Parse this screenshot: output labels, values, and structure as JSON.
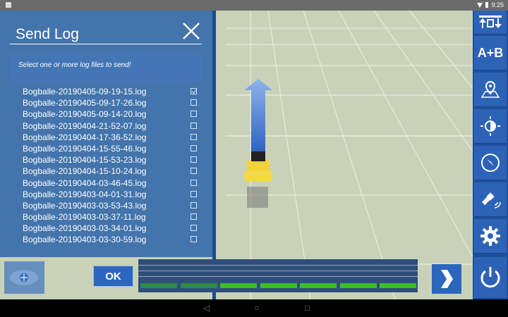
{
  "status": {
    "time": "9:25"
  },
  "dialog": {
    "title": "Send Log",
    "hint": "Select one or more log files to send!",
    "files": [
      {
        "name": "Bogballe-20190405-09-19-15.log",
        "checked": true
      },
      {
        "name": "Bogballe-20190405-09-17-26.log",
        "checked": false
      },
      {
        "name": "Bogballe-20190405-09-14-20.log",
        "checked": false
      },
      {
        "name": "Bogballe-20190404-21-52-07.log",
        "checked": false
      },
      {
        "name": "Bogballe-20190404-17-36-52.log",
        "checked": false
      },
      {
        "name": "Bogballe-20190404-15-55-46.log",
        "checked": false
      },
      {
        "name": "Bogballe-20190404-15-53-23.log",
        "checked": false
      },
      {
        "name": "Bogballe-20190404-15-10-24.log",
        "checked": false
      },
      {
        "name": "Bogballe-20190404-03-46-45.log",
        "checked": false
      },
      {
        "name": "Bogballe-20190403-04-01-31.log",
        "checked": false
      },
      {
        "name": "Bogballe-20190403-03-53-43.log",
        "checked": false
      },
      {
        "name": "Bogballe-20190403-03-37-11.log",
        "checked": false
      },
      {
        "name": "Bogballe-20190403-03-34-01.log",
        "checked": false
      },
      {
        "name": "Bogballe-20190403-03-30-59.log",
        "checked": false
      }
    ],
    "ok_label": "OK"
  },
  "sidebar": {
    "buttons": [
      {
        "icon": "section-arrows-icon"
      },
      {
        "icon": "ab-line-icon",
        "label": "A+B"
      },
      {
        "icon": "map-pin-icon"
      },
      {
        "icon": "brightness-icon"
      },
      {
        "icon": "compass-icon"
      },
      {
        "icon": "satellite-icon"
      },
      {
        "icon": "gear-icon"
      },
      {
        "icon": "power-icon"
      }
    ]
  },
  "colors": {
    "accent": "#2c66be",
    "field": "#c9d2b8",
    "meter_active": "#3dbd2c",
    "meter_inactive": "#2d8a4b"
  },
  "meter": {
    "segments": [
      {
        "active": false
      },
      {
        "active": false
      },
      {
        "active": true
      },
      {
        "active": true
      },
      {
        "active": true
      },
      {
        "active": true
      },
      {
        "active": true
      }
    ]
  }
}
